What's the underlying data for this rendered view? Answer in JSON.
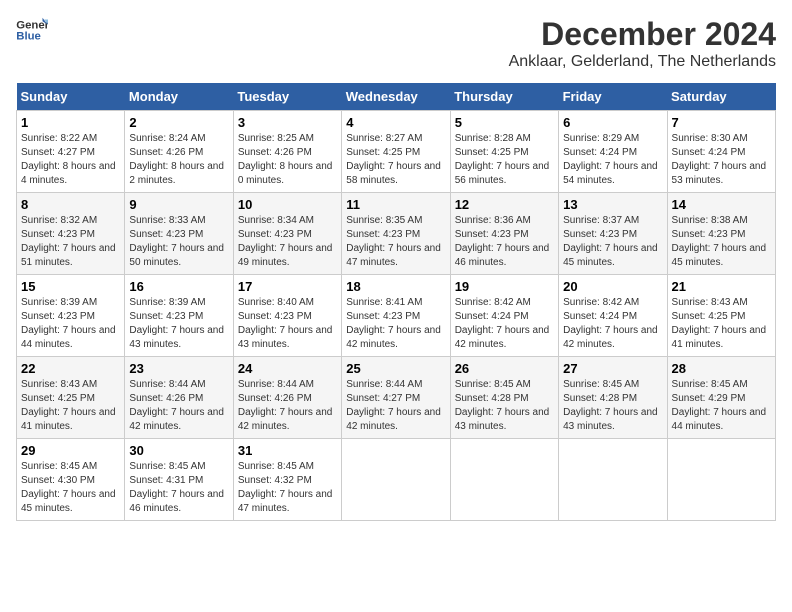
{
  "logo": {
    "line1": "General",
    "line2": "Blue"
  },
  "title": "December 2024",
  "subtitle": "Anklaar, Gelderland, The Netherlands",
  "days_of_week": [
    "Sunday",
    "Monday",
    "Tuesday",
    "Wednesday",
    "Thursday",
    "Friday",
    "Saturday"
  ],
  "weeks": [
    [
      {
        "day": 1,
        "sunrise": "8:22 AM",
        "sunset": "4:27 PM",
        "daylight": "8 hours and 4 minutes."
      },
      {
        "day": 2,
        "sunrise": "8:24 AM",
        "sunset": "4:26 PM",
        "daylight": "8 hours and 2 minutes."
      },
      {
        "day": 3,
        "sunrise": "8:25 AM",
        "sunset": "4:26 PM",
        "daylight": "8 hours and 0 minutes."
      },
      {
        "day": 4,
        "sunrise": "8:27 AM",
        "sunset": "4:25 PM",
        "daylight": "7 hours and 58 minutes."
      },
      {
        "day": 5,
        "sunrise": "8:28 AM",
        "sunset": "4:25 PM",
        "daylight": "7 hours and 56 minutes."
      },
      {
        "day": 6,
        "sunrise": "8:29 AM",
        "sunset": "4:24 PM",
        "daylight": "7 hours and 54 minutes."
      },
      {
        "day": 7,
        "sunrise": "8:30 AM",
        "sunset": "4:24 PM",
        "daylight": "7 hours and 53 minutes."
      }
    ],
    [
      {
        "day": 8,
        "sunrise": "8:32 AM",
        "sunset": "4:23 PM",
        "daylight": "7 hours and 51 minutes."
      },
      {
        "day": 9,
        "sunrise": "8:33 AM",
        "sunset": "4:23 PM",
        "daylight": "7 hours and 50 minutes."
      },
      {
        "day": 10,
        "sunrise": "8:34 AM",
        "sunset": "4:23 PM",
        "daylight": "7 hours and 49 minutes."
      },
      {
        "day": 11,
        "sunrise": "8:35 AM",
        "sunset": "4:23 PM",
        "daylight": "7 hours and 47 minutes."
      },
      {
        "day": 12,
        "sunrise": "8:36 AM",
        "sunset": "4:23 PM",
        "daylight": "7 hours and 46 minutes."
      },
      {
        "day": 13,
        "sunrise": "8:37 AM",
        "sunset": "4:23 PM",
        "daylight": "7 hours and 45 minutes."
      },
      {
        "day": 14,
        "sunrise": "8:38 AM",
        "sunset": "4:23 PM",
        "daylight": "7 hours and 45 minutes."
      }
    ],
    [
      {
        "day": 15,
        "sunrise": "8:39 AM",
        "sunset": "4:23 PM",
        "daylight": "7 hours and 44 minutes."
      },
      {
        "day": 16,
        "sunrise": "8:39 AM",
        "sunset": "4:23 PM",
        "daylight": "7 hours and 43 minutes."
      },
      {
        "day": 17,
        "sunrise": "8:40 AM",
        "sunset": "4:23 PM",
        "daylight": "7 hours and 43 minutes."
      },
      {
        "day": 18,
        "sunrise": "8:41 AM",
        "sunset": "4:23 PM",
        "daylight": "7 hours and 42 minutes."
      },
      {
        "day": 19,
        "sunrise": "8:42 AM",
        "sunset": "4:24 PM",
        "daylight": "7 hours and 42 minutes."
      },
      {
        "day": 20,
        "sunrise": "8:42 AM",
        "sunset": "4:24 PM",
        "daylight": "7 hours and 42 minutes."
      },
      {
        "day": 21,
        "sunrise": "8:43 AM",
        "sunset": "4:25 PM",
        "daylight": "7 hours and 41 minutes."
      }
    ],
    [
      {
        "day": 22,
        "sunrise": "8:43 AM",
        "sunset": "4:25 PM",
        "daylight": "7 hours and 41 minutes."
      },
      {
        "day": 23,
        "sunrise": "8:44 AM",
        "sunset": "4:26 PM",
        "daylight": "7 hours and 42 minutes."
      },
      {
        "day": 24,
        "sunrise": "8:44 AM",
        "sunset": "4:26 PM",
        "daylight": "7 hours and 42 minutes."
      },
      {
        "day": 25,
        "sunrise": "8:44 AM",
        "sunset": "4:27 PM",
        "daylight": "7 hours and 42 minutes."
      },
      {
        "day": 26,
        "sunrise": "8:45 AM",
        "sunset": "4:28 PM",
        "daylight": "7 hours and 43 minutes."
      },
      {
        "day": 27,
        "sunrise": "8:45 AM",
        "sunset": "4:28 PM",
        "daylight": "7 hours and 43 minutes."
      },
      {
        "day": 28,
        "sunrise": "8:45 AM",
        "sunset": "4:29 PM",
        "daylight": "7 hours and 44 minutes."
      }
    ],
    [
      {
        "day": 29,
        "sunrise": "8:45 AM",
        "sunset": "4:30 PM",
        "daylight": "7 hours and 45 minutes."
      },
      {
        "day": 30,
        "sunrise": "8:45 AM",
        "sunset": "4:31 PM",
        "daylight": "7 hours and 46 minutes."
      },
      {
        "day": 31,
        "sunrise": "8:45 AM",
        "sunset": "4:32 PM",
        "daylight": "7 hours and 47 minutes."
      },
      null,
      null,
      null,
      null
    ]
  ]
}
